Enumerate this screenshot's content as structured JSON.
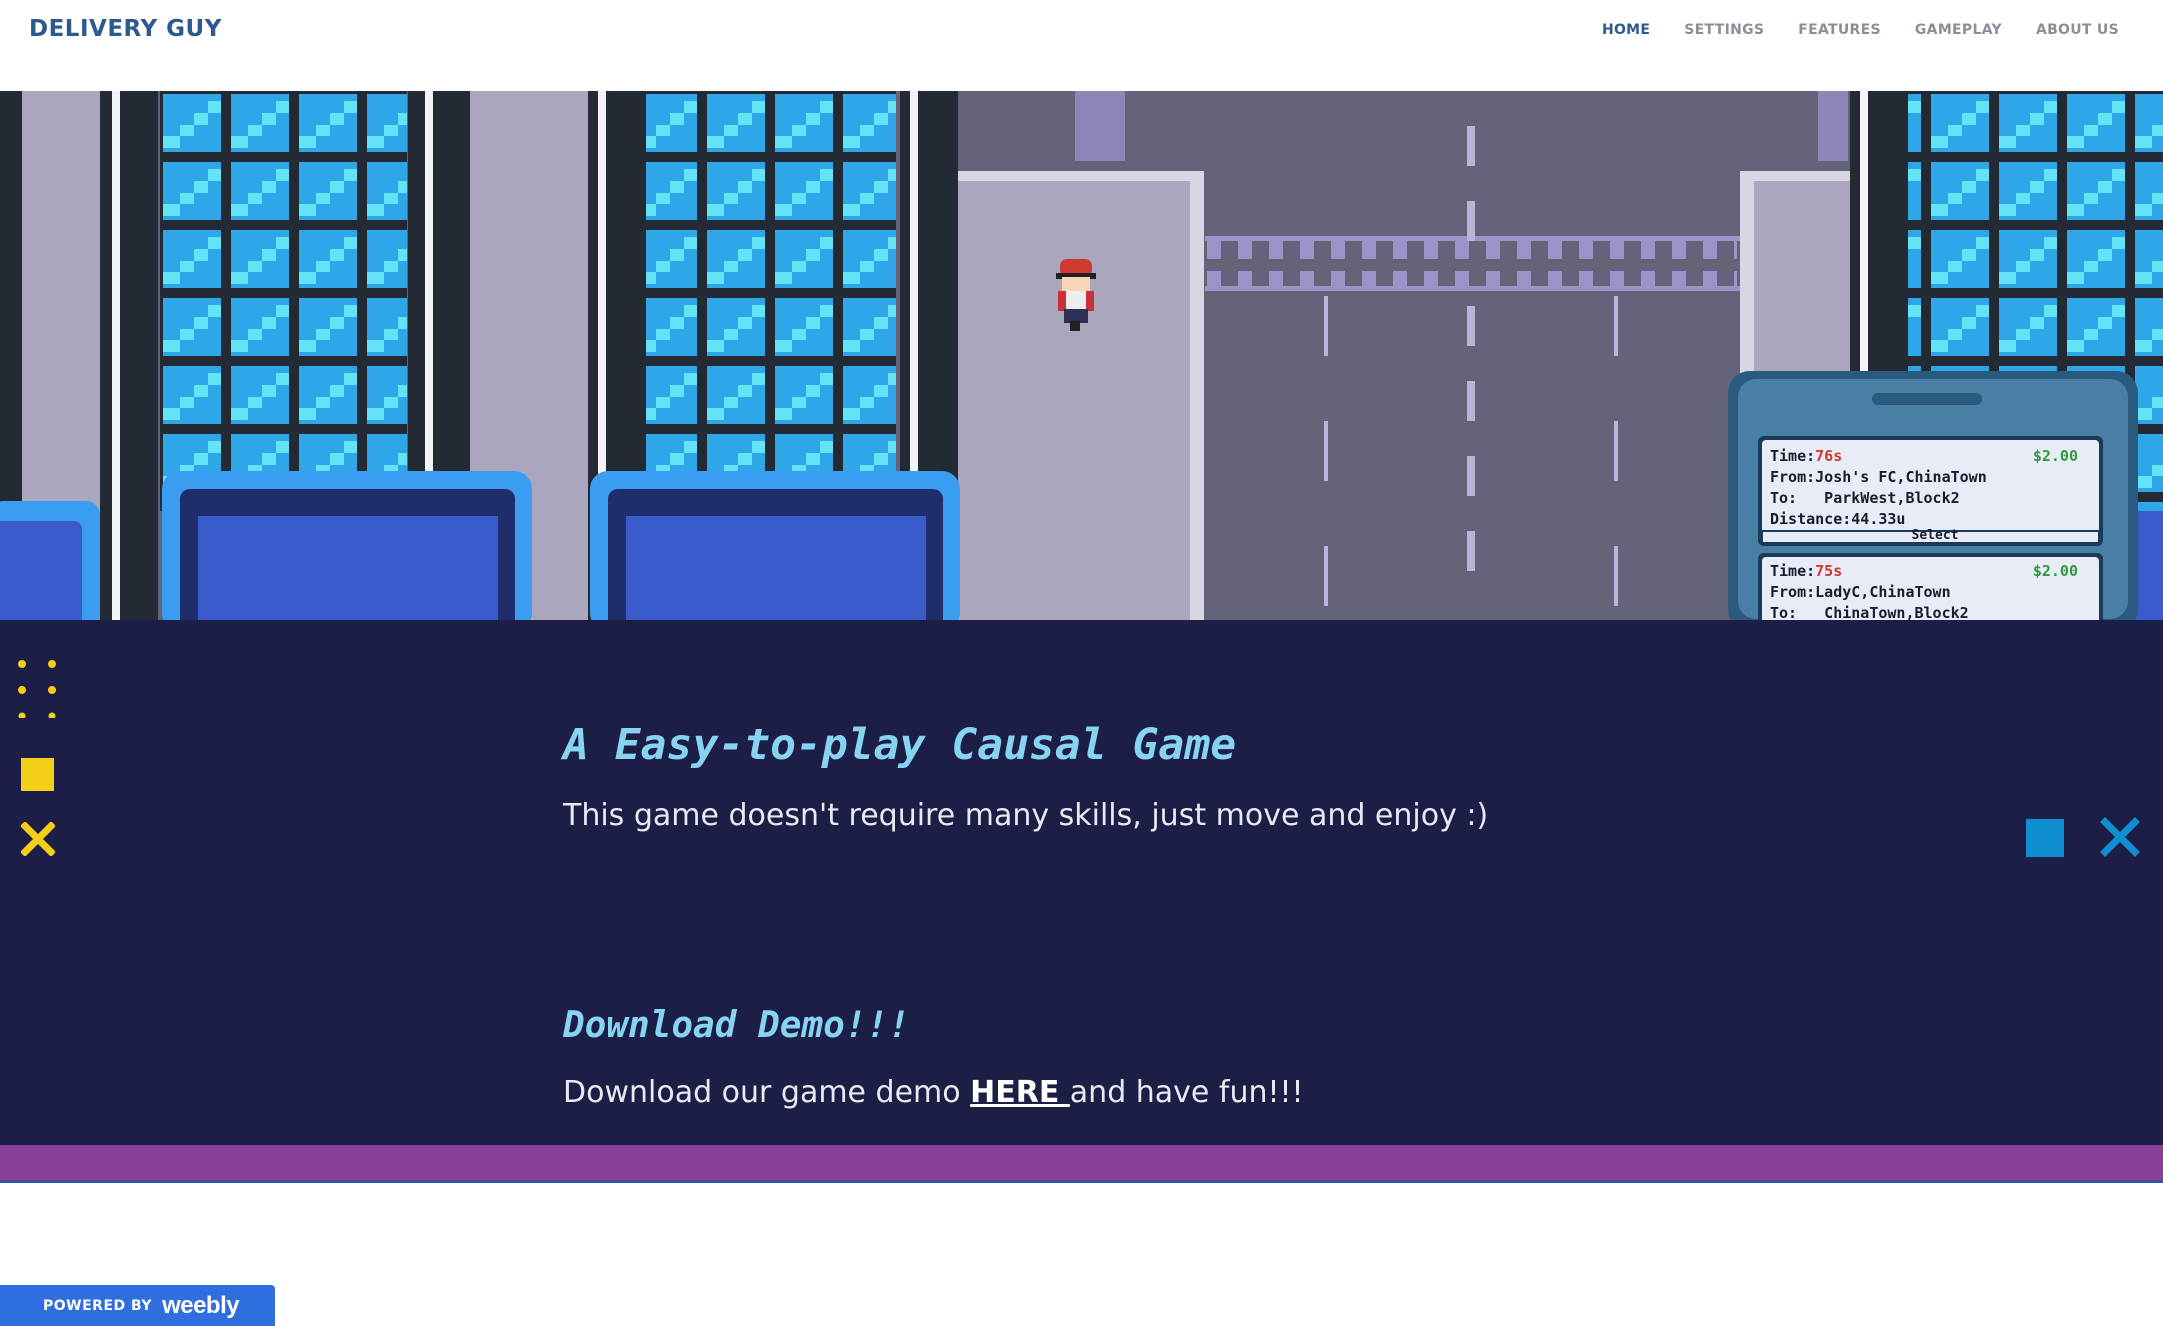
{
  "site": {
    "title": "DELIVERY GUY"
  },
  "nav": {
    "items": [
      {
        "label": "HOME",
        "active": true
      },
      {
        "label": "SETTINGS",
        "active": false
      },
      {
        "label": "FEATURES",
        "active": false
      },
      {
        "label": "GAMEPLAY",
        "active": false
      },
      {
        "label": "ABOUT US",
        "active": false
      }
    ]
  },
  "hero": {
    "phone": {
      "orders": [
        {
          "time_label": "Time:",
          "time": "76s",
          "price": "$2.00",
          "from": "From:Josh's FC,ChinaTown",
          "to": "To:   ParkWest,Block2",
          "distance": "Distance:44.33u",
          "select": "Select"
        },
        {
          "time_label": "Time:",
          "time": "75s",
          "price": "$2.00",
          "from": "From:LadyC,ChinaTown",
          "to": "To:   ChinaTown,Block2"
        }
      ]
    }
  },
  "section1": {
    "heading": "A Easy-to-play Causal Game",
    "text": "This game doesn't require many skills, just move and enjoy :)"
  },
  "section2": {
    "heading": "Download Demo!!!",
    "text_before": "Download our game demo ",
    "link": "HERE ",
    "text_after": "and have fun!!!"
  },
  "decor": {
    "accent_yellow": "#f4cf1a",
    "accent_blue": "#0f8fd1"
  },
  "footer": {
    "powered_by": "POWERED BY",
    "brand": "weebly"
  }
}
